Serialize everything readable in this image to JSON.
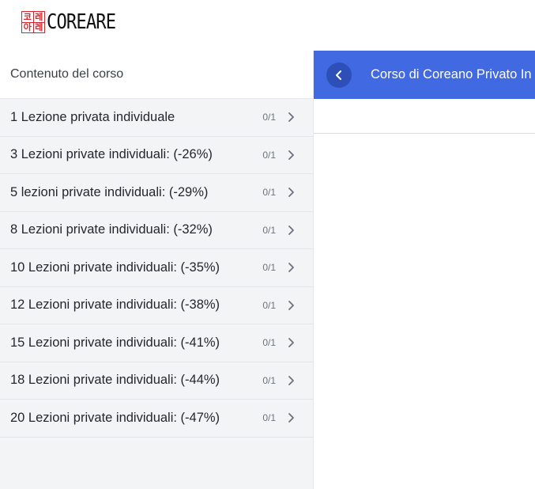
{
  "brand": {
    "logo_chars": [
      "코",
      "레",
      "아",
      "레"
    ],
    "name": "COREARE",
    "accent_color": "#d3252b"
  },
  "sidebar": {
    "header": "Contenuto del corso",
    "lessons": [
      {
        "title": "1 Lezione privata individuale",
        "progress": "0/1"
      },
      {
        "title": "3 Lezioni private individuali: (-26%)",
        "progress": "0/1"
      },
      {
        "title": "5 lezioni private individuali: (-29%)",
        "progress": "0/1"
      },
      {
        "title": "8 Lezioni private individuali: (-32%)",
        "progress": "0/1"
      },
      {
        "title": "10 Lezioni private individuali: (-35%)",
        "progress": "0/1"
      },
      {
        "title": "12 Lezioni private individuali: (-38%)",
        "progress": "0/1"
      },
      {
        "title": "15 Lezioni private individuali: (-41%)",
        "progress": "0/1"
      },
      {
        "title": "18 Lezioni private individuali: (-44%)",
        "progress": "0/1"
      },
      {
        "title": "20 Lezioni private individuali: (-47%)",
        "progress": "0/1"
      }
    ]
  },
  "main": {
    "title": "Corso di Coreano Privato In",
    "header_color": "#4169e1",
    "back_icon": "chevron-left-icon"
  }
}
